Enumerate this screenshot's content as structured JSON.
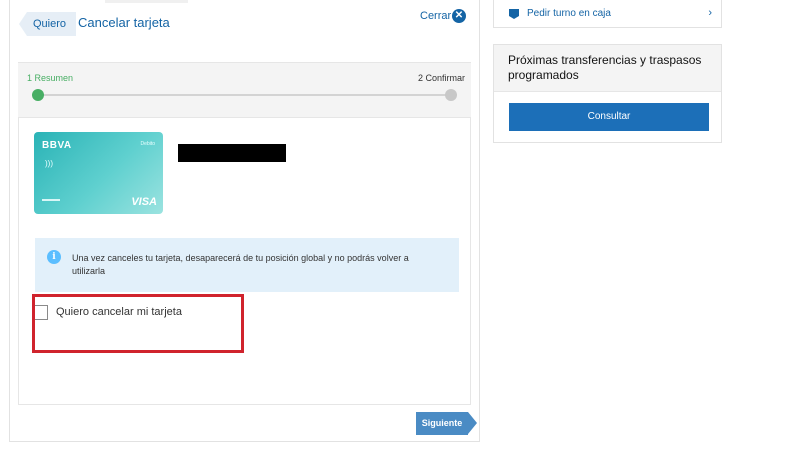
{
  "header": {
    "back_label": "Quiero",
    "title": "Cancelar tarjeta",
    "close_label": "Cerrar"
  },
  "stepper": {
    "steps": [
      {
        "label": "1 Resumen",
        "status": "active"
      },
      {
        "label": "2 Confirmar",
        "status": "pending"
      }
    ]
  },
  "card": {
    "brand": "BBVA",
    "type": "Debito",
    "network": "VISA"
  },
  "info": {
    "icon": "info-icon",
    "text": "Una vez canceles tu tarjeta, desaparecerá de tu posición global y no podrás volver a utilizarla"
  },
  "confirm": {
    "checkbox_label": "Quiero cancelar mi tarjeta",
    "checked": false
  },
  "footer": {
    "next_label": "Siguiente"
  },
  "sidebar": {
    "turno_label": "Pedir turno en caja",
    "transfer_title": "Próximas transferencias y traspasos programados",
    "consultar_label": "Consultar"
  },
  "colors": {
    "brand_blue": "#1464a5",
    "success_green": "#48ae64",
    "highlight_red": "#d0232d",
    "info_bg": "#e2f0fa"
  }
}
